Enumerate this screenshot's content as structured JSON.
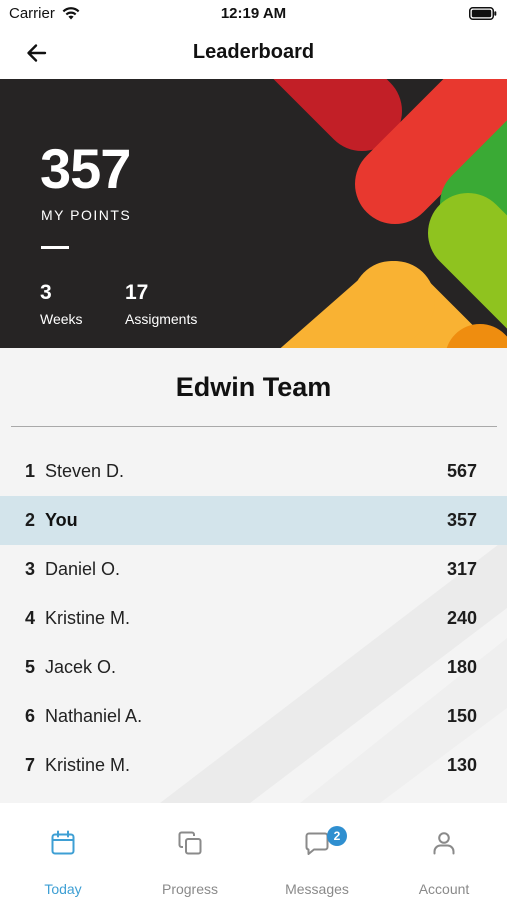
{
  "status_bar": {
    "carrier": "Carrier",
    "time": "12:19 AM"
  },
  "header": {
    "title": "Leaderboard",
    "back_icon": "arrow-left-icon"
  },
  "summary": {
    "points": "357",
    "points_label": "MY POINTS",
    "weeks_value": "3",
    "weeks_label": "Weeks",
    "assignments_value": "17",
    "assignments_label": "Assigments"
  },
  "team": {
    "name": "Edwin Team",
    "leaders": [
      {
        "rank": "1",
        "name": "Steven D.",
        "points": "567",
        "current": false
      },
      {
        "rank": "2",
        "name": "You",
        "points": "357",
        "current": true
      },
      {
        "rank": "3",
        "name": "Daniel O.",
        "points": "317",
        "current": false
      },
      {
        "rank": "4",
        "name": "Kristine M.",
        "points": "240",
        "current": false
      },
      {
        "rank": "5",
        "name": "Jacek O.",
        "points": "180",
        "current": false
      },
      {
        "rank": "6",
        "name": "Nathaniel A.",
        "points": "150",
        "current": false
      },
      {
        "rank": "7",
        "name": "Kristine M.",
        "points": "130",
        "current": false
      }
    ]
  },
  "tabs": [
    {
      "label": "Today",
      "icon": "calendar-icon",
      "active": true
    },
    {
      "label": "Progress",
      "icon": "copy-squares-icon",
      "active": false
    },
    {
      "label": "Messages",
      "icon": "message-icon",
      "active": false,
      "badge": "2"
    },
    {
      "label": "Account",
      "icon": "person-icon",
      "active": false
    }
  ],
  "colors": {
    "hero_background": "#262424",
    "accent": "#3e9fd4",
    "badge": "#2f8fd0",
    "current_row": "#d3e4eb",
    "shape_red_dark": "#c21f27",
    "shape_red": "#e8382f",
    "shape_green": "#3aaa35",
    "shape_lime": "#8fc31f",
    "shape_yellow": "#f9b233",
    "shape_orange": "#ef8d0f"
  }
}
